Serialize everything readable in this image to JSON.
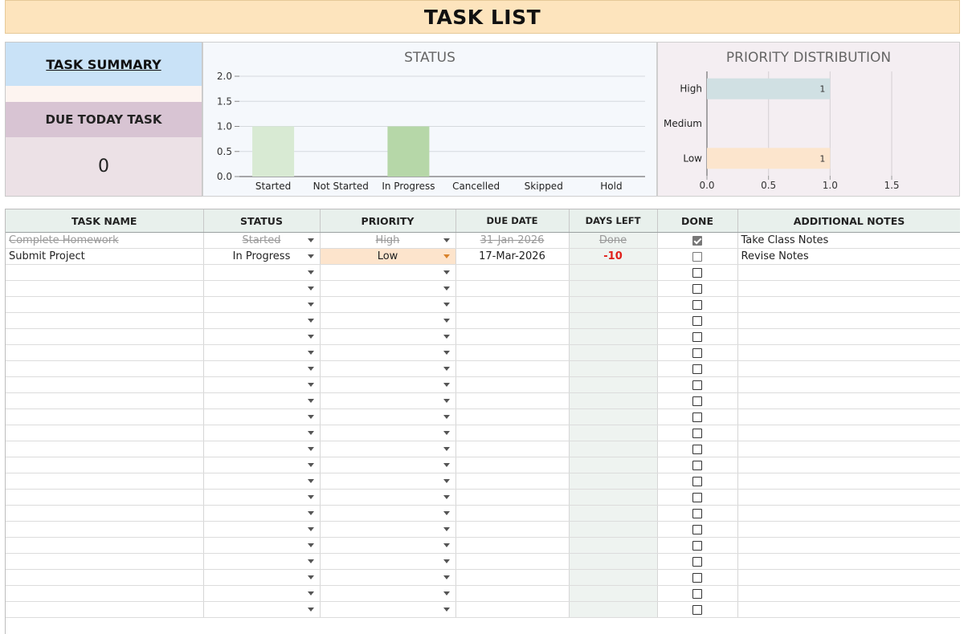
{
  "title": "TASK LIST",
  "summary": {
    "heading": "TASK SUMMARY",
    "due_today_label": "DUE TODAY TASK",
    "due_today_count": "0"
  },
  "chart_data": [
    {
      "type": "bar",
      "title": "STATUS",
      "categories": [
        "Started",
        "Not Started",
        "In Progress",
        "Cancelled",
        "Skipped",
        "Hold"
      ],
      "values": [
        1,
        0,
        1,
        0,
        0,
        0
      ],
      "colors": [
        "#d8ead3",
        "#d8ead3",
        "#b6d7a8",
        "#d8ead3",
        "#d8ead3",
        "#d8ead3"
      ],
      "ylim": [
        0,
        2
      ],
      "yticks": [
        "0.0",
        "0.5",
        "1.0",
        "1.5",
        "2.0"
      ],
      "grid": true
    },
    {
      "type": "bar",
      "orientation": "horizontal",
      "title": "PRIORITY DISTRIBUTION",
      "categories": [
        "High",
        "Medium",
        "Low"
      ],
      "values": [
        1,
        0,
        1
      ],
      "colors": [
        "#d0e0e3",
        "#d9d2e9",
        "#fce5cd"
      ],
      "data_labels": [
        "1",
        "",
        "1"
      ],
      "xlim": [
        0,
        1.5
      ],
      "xticks": [
        "0.0",
        "0.5",
        "1.0",
        "1.5"
      ],
      "grid": true
    }
  ],
  "table": {
    "headers": [
      "TASK NAME",
      "STATUS",
      "PRIORITY",
      "DUE DATE",
      "DAYS LEFT",
      "DONE",
      "ADDITIONAL NOTES"
    ],
    "rows": [
      {
        "task": "Complete Homework",
        "status": "Started",
        "priority": "High",
        "due": "31-Jan-2026",
        "days_left": "Done",
        "done": true,
        "notes": "Take Class Notes"
      },
      {
        "task": "Submit Project",
        "status": "In Progress",
        "priority": "Low",
        "due": "17-Mar-2026",
        "days_left": "-10",
        "done": false,
        "notes": "Revise Notes"
      }
    ],
    "empty_rows": 22
  }
}
